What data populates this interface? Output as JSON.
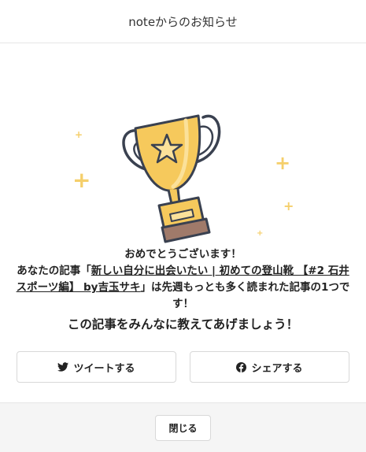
{
  "header": {
    "title": "noteからのお知らせ"
  },
  "message": {
    "line1": "おめでとうございます！",
    "prefix": "あなたの記事「",
    "article_title": "新しい自分に出会いたい | 初めての登山靴 【#2 石井スポーツ編】 by吉玉サキ",
    "suffix": "」は先週もっとも多く読まれた記事の1つです！",
    "cta": "この記事をみんなに教えてあげましょう！"
  },
  "buttons": {
    "tweet_label": "ツイートする",
    "share_label": "シェアする"
  },
  "footer": {
    "close_label": "閉じる"
  },
  "icons": {
    "tweet": "twitter-bird-icon",
    "share": "facebook-icon",
    "trophy": "trophy-icon"
  },
  "colors": {
    "trophy_gold": "#f6c95c",
    "trophy_base": "#a07a6a",
    "outline": "#3a4150",
    "sparkle": "#f5cf6b"
  }
}
